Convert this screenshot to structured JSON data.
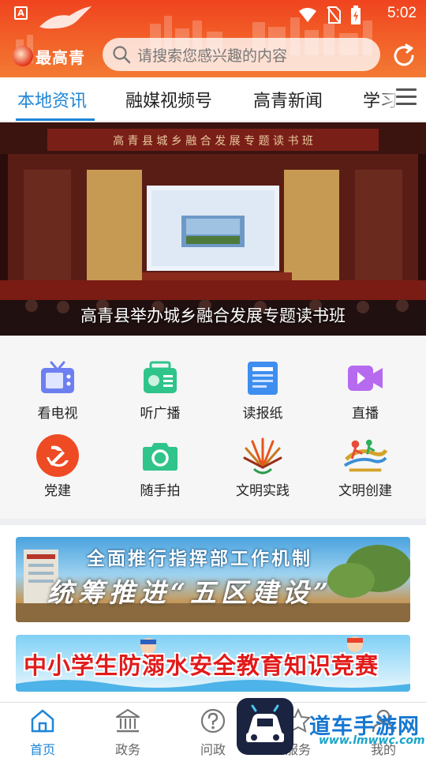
{
  "status_bar": {
    "time": "5:02",
    "indicator": "A"
  },
  "header": {
    "logo_text": "最高青",
    "search_placeholder": "请搜索您感兴趣的内容"
  },
  "tabs": [
    {
      "label": "本地资讯",
      "active": true
    },
    {
      "label": "融媒视频号"
    },
    {
      "label": "高青新闻"
    },
    {
      "label": "学习"
    }
  ],
  "banner": {
    "caption": "高青县举办城乡融合发展专题读书班",
    "backdrop_text": "高 青 县 城 乡 融 合 发 展 专 题 读 书 班"
  },
  "grid": [
    {
      "label": "看电视",
      "icon": "tv-icon",
      "color": "#6d7ff0"
    },
    {
      "label": "听广播",
      "icon": "radio-icon",
      "color": "#2fc48a"
    },
    {
      "label": "读报纸",
      "icon": "newspaper-icon",
      "color": "#3e8ef0"
    },
    {
      "label": "直播",
      "icon": "live-camera-icon",
      "color": "#b56af0"
    },
    {
      "label": "党建",
      "icon": "party-emblem-icon",
      "color": "#ee4b24"
    },
    {
      "label": "随手拍",
      "icon": "camera-icon",
      "color": "#2fc48a"
    },
    {
      "label": "文明实践",
      "icon": "civilization-practice-logo",
      "color": "#e8541a"
    },
    {
      "label": "文明创建",
      "icon": "civilization-creation-logo",
      "color": "#d4a32a"
    }
  ],
  "promos": [
    {
      "title": "全面推行指挥部工作机制",
      "subtitle": "统筹推进“五区建设”"
    },
    {
      "title": "中小学生防溺水安全教育知识竞赛"
    }
  ],
  "bottom_nav": [
    {
      "label": "首页",
      "icon": "home-icon",
      "active": true
    },
    {
      "label": "政务",
      "icon": "government-building-icon"
    },
    {
      "label": "问政",
      "icon": "question-icon"
    },
    {
      "label": "服务",
      "icon": "service-star-icon"
    },
    {
      "label": "我的",
      "icon": "user-icon"
    }
  ],
  "watermark": {
    "text": "道车手游网",
    "url": "www.lmwwc.com"
  },
  "colors": {
    "header": "#f0441f",
    "accent": "#1f86d7"
  }
}
